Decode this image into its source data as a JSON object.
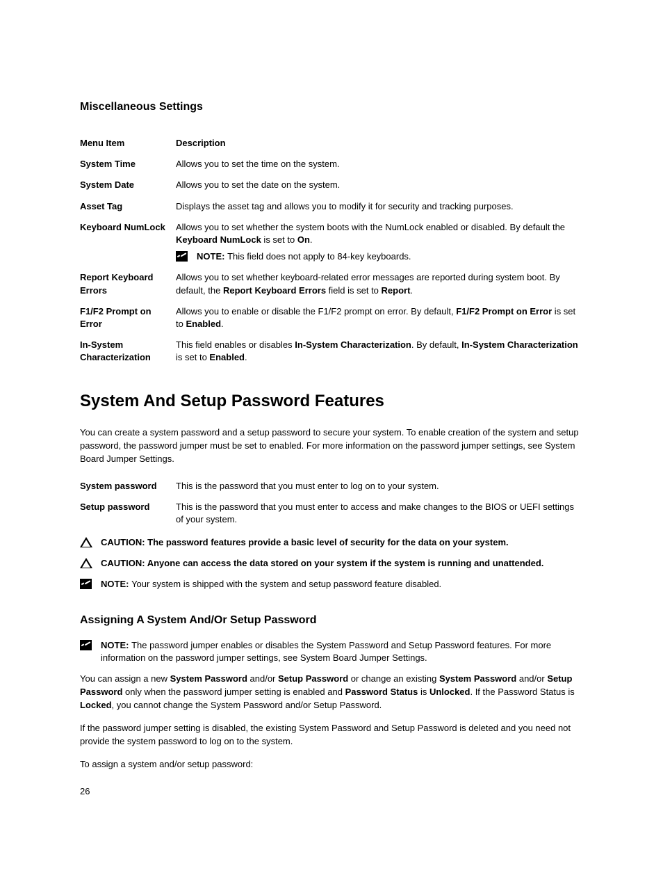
{
  "section_title": "Miscellaneous Settings",
  "table_header": {
    "col1": "Menu Item",
    "col2": "Description"
  },
  "rows": [
    {
      "label": "System Time",
      "desc": "Allows you to set the time on the system."
    },
    {
      "label": "System Date",
      "desc": "Allows you to set the date on the system."
    },
    {
      "label": "Asset Tag",
      "desc": "Displays the asset tag and allows you to modify it for security and tracking purposes."
    }
  ],
  "numlock": {
    "label": "Keyboard NumLock",
    "pre": "Allows you to set whether the system boots with the NumLock enabled or disabled. By default the ",
    "b1": "Keyboard NumLock",
    "mid": " is set to ",
    "b2": "On",
    "post": ".",
    "note_label": "NOTE: ",
    "note_text": "This field does not apply to 84-key keyboards."
  },
  "report": {
    "label": "Report Keyboard Errors",
    "pre": "Allows you to set whether keyboard-related error messages are reported during system boot. By default, the ",
    "b1": "Report Keyboard Errors",
    "mid": " field is set to ",
    "b2": "Report",
    "post": "."
  },
  "f1f2": {
    "label": "F1/F2 Prompt on Error",
    "pre": "Allows you to enable or disable the F1/F2 prompt on error. By default, ",
    "b1": "F1/F2 Prompt on Error",
    "mid": " is set to ",
    "b2": "Enabled",
    "post": "."
  },
  "insys": {
    "label": "In-System Characterization",
    "pre": "This field enables or disables ",
    "b1": "In-System Characterization",
    "mid1": ". By default, ",
    "b2": "In-System Characterization",
    "mid2": " is set to ",
    "b3": "Enabled",
    "post": "."
  },
  "main_heading": "System And Setup Password Features",
  "intro": "You can create a system password and a setup password to secure your system. To enable creation of the system and setup password, the password jumper must be set to enabled. For more information on the password jumper settings, see System Board Jumper Settings.",
  "defs2": [
    {
      "label": "System password",
      "desc": "This is the password that you must enter to log on to your system."
    },
    {
      "label": "Setup password",
      "desc": "This is the password that you must enter to access and make changes to the BIOS or UEFI settings of your system."
    }
  ],
  "caution1": {
    "label": "CAUTION: ",
    "text": "The password features provide a basic level of security for the data on your system."
  },
  "caution2": {
    "label": "CAUTION: ",
    "text": "Anyone can access the data stored on your system if the system is running and unattended."
  },
  "note1": {
    "label": "NOTE: ",
    "text": "Your system is shipped with the system and setup password feature disabled."
  },
  "sub_heading": "Assigning A System And/Or Setup Password",
  "note2": {
    "label": "NOTE: ",
    "text": "The password jumper enables or disables the System Password and Setup Password features. For more information on the password jumper settings, see System Board Jumper Settings."
  },
  "para1": {
    "p1": "You can assign a new ",
    "b1": "System Password",
    "p2": " and/or ",
    "b2": "Setup Password",
    "p3": " or change an existing ",
    "b3": "System Password",
    "p4": " and/or ",
    "b4": "Setup Password",
    "p5": " only when the password jumper setting is enabled and ",
    "b5": "Password Status",
    "p6": " is ",
    "b6": "Unlocked",
    "p7": ". If the Password Status is ",
    "b7": "Locked",
    "p8": ", you cannot change the System Password and/or Setup Password."
  },
  "para2": "If the password jumper setting is disabled, the existing System Password and Setup Password is deleted and you need not provide the system password to log on to the system.",
  "para3": "To assign a system and/or setup password:",
  "page_number": "26"
}
